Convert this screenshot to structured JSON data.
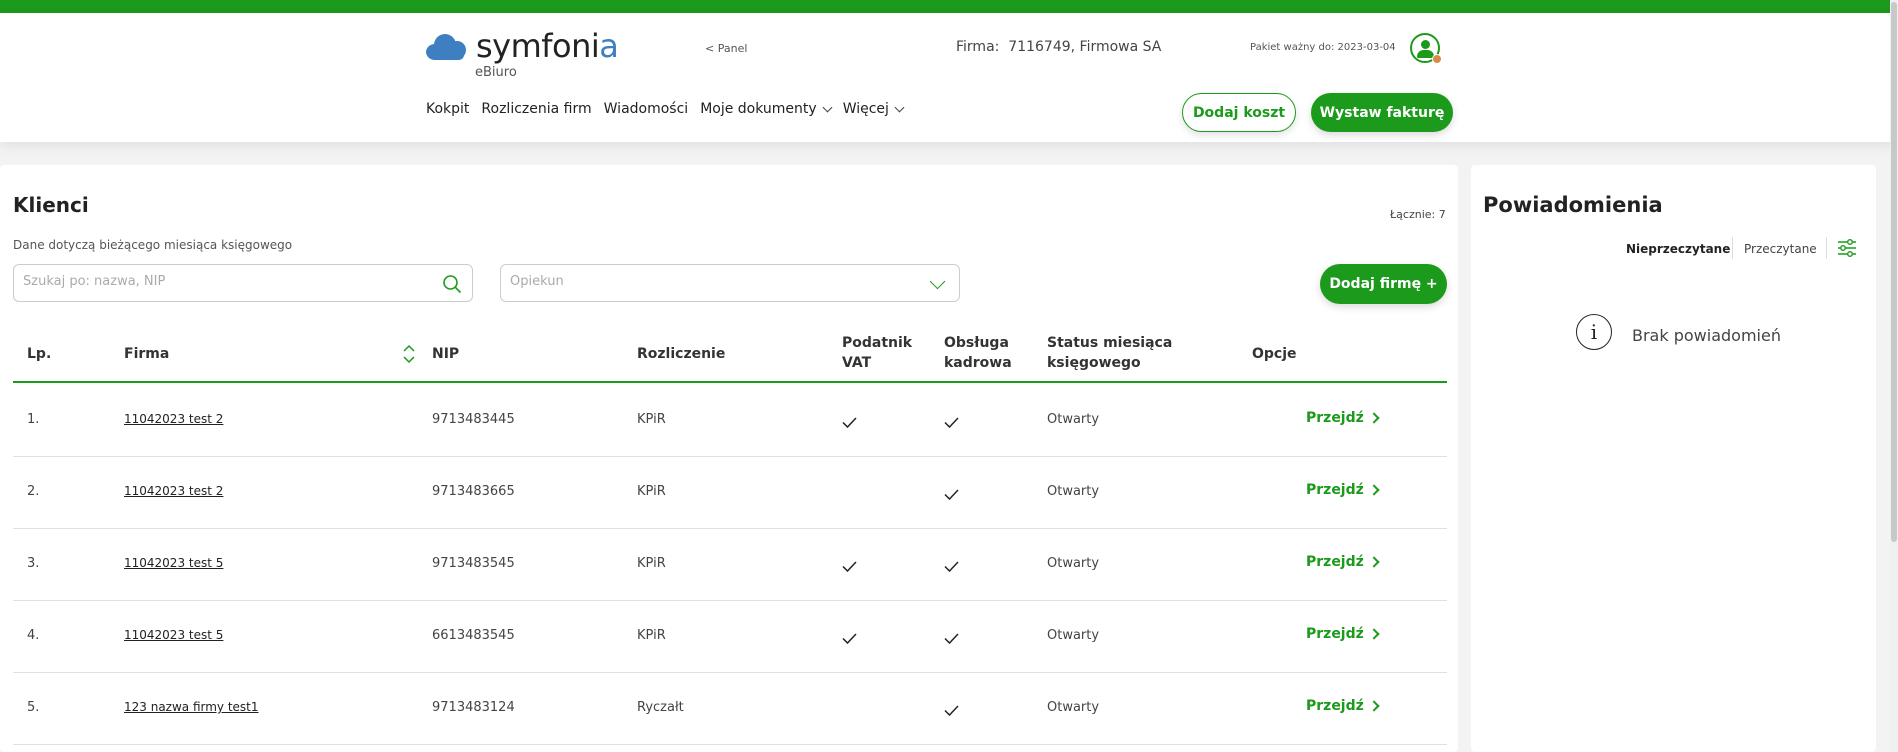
{
  "header": {
    "logo_text": "symfonia",
    "product": "eBiuro",
    "panel_link": "< Panel",
    "firma_label": "Firma:",
    "firma_value": "7116749, Firmowa SA",
    "pakiet": "Pakiet ważny do: 2023-03-04",
    "nav": [
      {
        "label": "Kokpit"
      },
      {
        "label": "Rozliczenia firm"
      },
      {
        "label": "Wiadomości"
      },
      {
        "label": "Moje dokumenty"
      },
      {
        "label": "Więcej"
      }
    ],
    "dodaj_koszt": "Dodaj koszt",
    "wystaw_fakture": "Wystaw fakturę"
  },
  "clients": {
    "title": "Klienci",
    "total": "Łącznie: 7",
    "subtitle": "Dane dotyczą bieżącego miesiąca księgowego",
    "search_placeholder": "Szukaj po: nazwa, NIP",
    "opiekun_placeholder": "Opiekun",
    "add_button": "Dodaj firmę +",
    "columns": {
      "lp": "Lp.",
      "firma": "Firma",
      "nip": "NIP",
      "rozliczenie": "Rozliczenie",
      "vat": "Podatnik VAT",
      "kadrowa": "Obsługa kadrowa",
      "status": "Status miesiąca księgowego",
      "opcje": "Opcje"
    },
    "action_label": "Przejdź",
    "rows": [
      {
        "lp": "1.",
        "firma": "11042023 test 2",
        "nip": "9713483445",
        "rozliczenie": "KPiR",
        "vat": true,
        "kadrowa": true,
        "status": "Otwarty"
      },
      {
        "lp": "2.",
        "firma": "11042023 test 2",
        "nip": "9713483665",
        "rozliczenie": "KPiR",
        "vat": false,
        "kadrowa": true,
        "status": "Otwarty"
      },
      {
        "lp": "3.",
        "firma": "11042023 test 5",
        "nip": "9713483545",
        "rozliczenie": "KPiR",
        "vat": true,
        "kadrowa": true,
        "status": "Otwarty"
      },
      {
        "lp": "4.",
        "firma": "11042023 test 5",
        "nip": "6613483545",
        "rozliczenie": "KPiR",
        "vat": true,
        "kadrowa": true,
        "status": "Otwarty"
      },
      {
        "lp": "5.",
        "firma": "123 nazwa firmy test1",
        "nip": "9713483124",
        "rozliczenie": "Ryczałt",
        "vat": false,
        "kadrowa": true,
        "status": "Otwarty"
      }
    ]
  },
  "notifications": {
    "title": "Powiadomienia",
    "tab_unread": "Nieprzeczytane",
    "tab_read": "Przeczytane",
    "empty": "Brak powiadomień"
  },
  "colors": {
    "accent": "#1c9a1c",
    "logo_blue": "#3d7fc1"
  }
}
